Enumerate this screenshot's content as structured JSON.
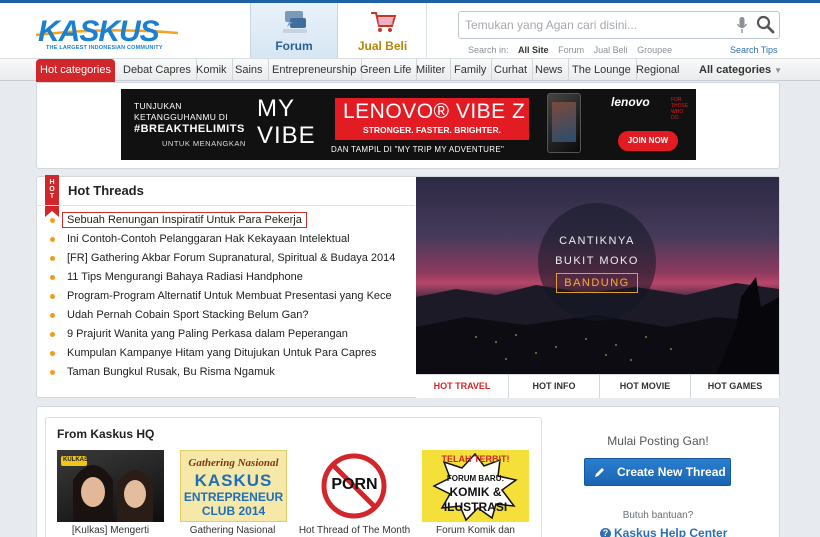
{
  "header": {
    "logo_text": "KASKUS",
    "logo_tagline": "THE LARGEST INDONESIAN COMMUNITY",
    "nav_tabs": [
      {
        "label": "Forum",
        "icon": "forum-icon"
      },
      {
        "label": "Jual Beli",
        "icon": "shopping-cart-icon"
      }
    ],
    "search": {
      "placeholder": "Temukan yang Agan cari disini...",
      "search_in_label": "Search in:",
      "scopes": [
        "All Site",
        "Forum",
        "Jual Beli",
        "Groupee"
      ],
      "selected_scope": "All Site",
      "tips_label": "Search Tips"
    }
  },
  "categories": {
    "hot_label": "Hot categories",
    "items": [
      "Debat Capres",
      "Komik",
      "Sains",
      "Entrepreneurship",
      "Green Life",
      "Militer",
      "Family",
      "Curhat",
      "News",
      "The Lounge",
      "Regional"
    ],
    "all_label": "All categories"
  },
  "banner": {
    "line1": "TUNJUKAN",
    "line2": "KETANGGUHANMU DI",
    "hashtag": "#BREAKTHELIMITS",
    "untuk": "UNTUK MENANGKAN",
    "my": "MY",
    "vibe": "VIBE",
    "product": "LENOVO® VIBE Z",
    "tagline": "STRONGER. FASTER. BRIGHTER.",
    "subtitle": "DAN TAMPIL DI \"MY TRIP MY ADVENTURE\"",
    "brand": "lenovo",
    "brand_sub": "FOR THOSE WHO DO.",
    "join_label": "JOIN NOW"
  },
  "hot_threads": {
    "badge": "HOT",
    "title": "Hot Threads",
    "items": [
      "Sebuah Renungan Inspiratif Untuk Para Pekerja",
      "Ini Contoh-Contoh Pelanggaran Hak Kekayaan Intelektual",
      "[FR] Gathering Akbar Forum Supranatural, Spiritual & Budaya 2014",
      "11 Tips Mengurangi Bahaya Radiasi Handphone",
      "Program-Program Alternatif Untuk Membuat Presentasi yang Kece",
      "Udah Pernah Cobain Sport Stacking Belum Gan?",
      "9 Prajurit Wanita yang Paling Perkasa dalam Peperangan",
      "Kumpulan Kampanye Hitam yang Ditujukan Untuk Para Capres",
      "Taman Bungkul Rusak, Bu Risma Ngamuk"
    ],
    "highlighted_index": 0
  },
  "feature": {
    "line1": "CANTIKNYA",
    "line2": "BUKIT MOKO",
    "line3": "BANDUNG",
    "tabs": [
      "HOT TRAVEL",
      "HOT INFO",
      "HOT MOVIE",
      "HOT GAMES"
    ],
    "active_tab": "HOT TRAVEL"
  },
  "from_hq": {
    "title": "From Kaskus HQ",
    "items": [
      {
        "caption": "[Kulkas] Mengerti",
        "thumb_text": "KULKAS"
      },
      {
        "caption": "Gathering Nasional",
        "thumb_text": "Gathering Nasional",
        "thumb_text2": "KASKUS",
        "thumb_text3": "ENTREPRENEUR",
        "thumb_text4": "CLUB 2014"
      },
      {
        "caption": "Hot Thread of The Month",
        "thumb_text": "PORN"
      },
      {
        "caption": "Forum Komik dan",
        "thumb_text": "TELAH TERBIT!",
        "thumb_text2": "FORUM BARU:",
        "thumb_text3": "KOMIK &",
        "thumb_text4": "ILUSTRASI"
      }
    ]
  },
  "sidebar": {
    "prompt": "Mulai Posting Gan!",
    "create_label": "Create New Thread",
    "help_question": "Butuh bantuan?",
    "help_link": "Kaskus Help Center"
  },
  "colors": {
    "brand_blue": "#1b80cf",
    "hot_red": "#d3262a",
    "bullet_orange": "#f29b1d",
    "button_blue": "#1a64b0"
  }
}
